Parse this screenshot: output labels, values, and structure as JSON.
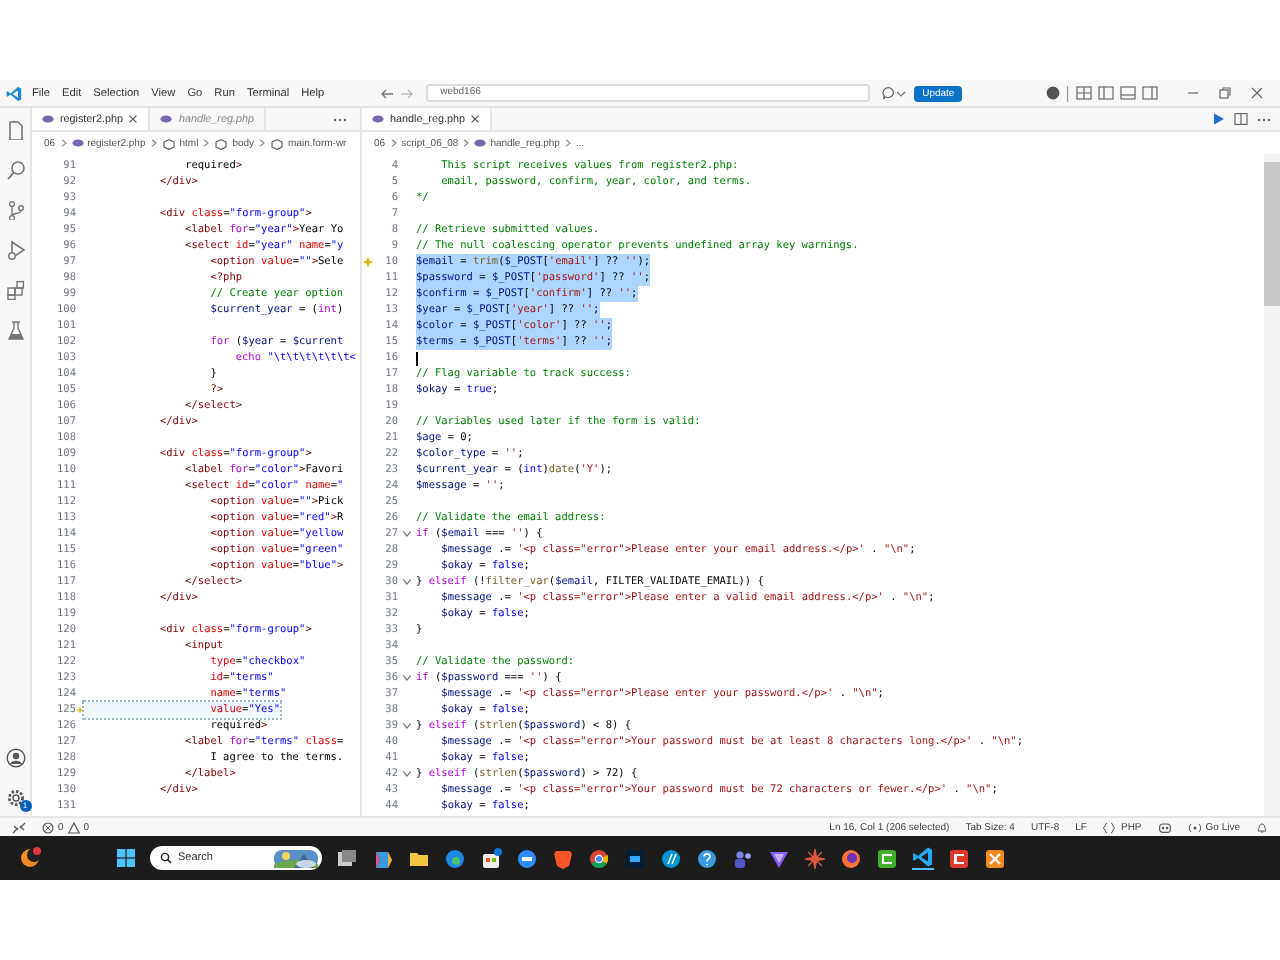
{
  "title_bar": {
    "menus": [
      "File",
      "Edit",
      "Selection",
      "View",
      "Go",
      "Run",
      "Terminal",
      "Help"
    ],
    "command_center": "webd166",
    "update_button": "Update"
  },
  "activity_bar": {
    "items": [
      {
        "kind": "explorer",
        "selected": false
      },
      {
        "kind": "search",
        "selected": false
      },
      {
        "kind": "source-control",
        "selected": false
      },
      {
        "kind": "run",
        "selected": false
      },
      {
        "kind": "extensions",
        "selected": false
      },
      {
        "kind": "testing",
        "selected": false
      }
    ],
    "settings_badge": "1"
  },
  "left_editor": {
    "tabs": [
      {
        "label": "register2.php",
        "selected": true,
        "preview": false
      },
      {
        "label": "handle_reg.php",
        "selected": false,
        "preview": true
      }
    ],
    "breadcrumbs": [
      {
        "kind": "folder",
        "label": "06"
      },
      {
        "kind": "file",
        "label": "register2.php"
      },
      {
        "kind": "element",
        "label": "html"
      },
      {
        "kind": "element",
        "label": "body"
      },
      {
        "kind": "element",
        "label": "main.form-wr"
      }
    ],
    "lines": [
      {
        "number": "91",
        "text": "                required>",
        "lightbulb": false,
        "highlighted": false
      },
      {
        "number": "92",
        "text": "            </div>",
        "lightbulb": false,
        "highlighted": false
      },
      {
        "number": "93",
        "lightbulb": false,
        "highlighted": false
      },
      {
        "number": "94",
        "text": "            <div class=\"form-group\">",
        "lightbulb": false,
        "highlighted": false
      },
      {
        "number": "95",
        "text": "                <label for=\"year\">Year Yo",
        "lightbulb": false,
        "highlighted": false
      },
      {
        "number": "96",
        "text": "                <select id=\"year\" name=\"y",
        "lightbulb": false,
        "highlighted": false
      },
      {
        "number": "97",
        "text": "                    <option value=\"\">Sele",
        "lightbulb": false,
        "highlighted": false
      },
      {
        "number": "98",
        "text": "                    <?php",
        "lightbulb": false,
        "highlighted": false
      },
      {
        "number": "99",
        "text": "                    // Create year option",
        "lightbulb": false,
        "highlighted": false
      },
      {
        "number": "100",
        "text": "                    $current_year = (int)",
        "lightbulb": false,
        "highlighted": false
      },
      {
        "number": "101",
        "lightbulb": false,
        "highlighted": false
      },
      {
        "number": "102",
        "text": "                    for ($year = $current",
        "lightbulb": false,
        "highlighted": false
      },
      {
        "number": "103",
        "text": "                        echo \"\\t\\t\\t\\t\\t\\t<",
        "lightbulb": false,
        "highlighted": false
      },
      {
        "number": "104",
        "text": "                    }",
        "lightbulb": false,
        "highlighted": false
      },
      {
        "number": "105",
        "text": "                    ?>",
        "lightbulb": false,
        "highlighted": false
      },
      {
        "number": "106",
        "text": "                </select>",
        "lightbulb": false,
        "highlighted": false
      },
      {
        "number": "107",
        "text": "            </div>",
        "lightbulb": false,
        "highlighted": false
      },
      {
        "number": "108",
        "lightbulb": false,
        "highlighted": false
      },
      {
        "number": "109",
        "text": "            <div class=\"form-group\">",
        "lightbulb": false,
        "highlighted": false
      },
      {
        "number": "110",
        "text": "                <label for=\"color\">Favori",
        "lightbulb": false,
        "highlighted": false
      },
      {
        "number": "111",
        "text": "                <select id=\"color\" name=\"",
        "lightbulb": false,
        "highlighted": false
      },
      {
        "number": "112",
        "text": "                    <option value=\"\">Pick",
        "lightbulb": false,
        "highlighted": false
      },
      {
        "number": "113",
        "text": "                    <option value=\"red\">R",
        "lightbulb": false,
        "highlighted": false
      },
      {
        "number": "114",
        "text": "                    <option value=\"yellow",
        "lightbulb": false,
        "highlighted": false
      },
      {
        "number": "115",
        "text": "                    <option value=\"green\"",
        "lightbulb": false,
        "highlighted": false
      },
      {
        "number": "116",
        "text": "                    <option value=\"blue\">",
        "lightbulb": false,
        "highlighted": false
      },
      {
        "number": "117",
        "text": "                </select>",
        "lightbulb": false,
        "highlighted": false
      },
      {
        "number": "118",
        "text": "            </div>",
        "lightbulb": false,
        "highlighted": false
      },
      {
        "number": "119",
        "lightbulb": false,
        "highlighted": false
      },
      {
        "number": "120",
        "text": "            <div class=\"form-group\">",
        "lightbulb": false,
        "highlighted": false
      },
      {
        "number": "121",
        "text": "                <input",
        "lightbulb": false,
        "highlighted": false
      },
      {
        "number": "122",
        "text": "                    type=\"checkbox\"",
        "lightbulb": false,
        "highlighted": false
      },
      {
        "number": "123",
        "text": "                    id=\"terms\"",
        "lightbulb": false,
        "highlighted": false
      },
      {
        "number": "124",
        "text": "                    name=\"terms\"",
        "lightbulb": false,
        "highlighted": false
      },
      {
        "number": "125",
        "text": "                    value=\"Yes\"",
        "lightbulb": true,
        "highlighted": true
      },
      {
        "number": "126",
        "text": "                    required>",
        "lightbulb": false,
        "highlighted": false
      },
      {
        "number": "127",
        "text": "                <label for=\"terms\" class=",
        "lightbulb": false,
        "highlighted": false
      },
      {
        "number": "128",
        "text": "                    I agree to the terms.",
        "lightbulb": false,
        "highlighted": false
      },
      {
        "number": "129",
        "text": "                </label>",
        "lightbulb": false,
        "highlighted": false
      },
      {
        "number": "130",
        "text": "            </div>",
        "lightbulb": false,
        "highlighted": false
      },
      {
        "number": "131",
        "lightbulb": false,
        "highlighted": false
      }
    ]
  },
  "right_editor": {
    "tabs": [
      {
        "label": "handle_reg.php",
        "selected": true,
        "preview": false
      }
    ],
    "breadcrumbs": [
      {
        "kind": "folder",
        "label": "06"
      },
      {
        "kind": "folder",
        "label": "script_06_08"
      },
      {
        "kind": "file",
        "label": "handle_reg.php"
      },
      {
        "kind": "more",
        "label": "..."
      }
    ],
    "lines": [
      {
        "number": "4",
        "kind": "comment",
        "text": "    This script receives values from register2.php:",
        "selected": false,
        "cursor": false,
        "foldable": false,
        "lightbulb": false
      },
      {
        "number": "5",
        "kind": "comment",
        "text": "    email, password, confirm, year, color, and terms.",
        "selected": false,
        "cursor": false,
        "foldable": false,
        "lightbulb": false
      },
      {
        "number": "6",
        "kind": "comment",
        "text": "*/",
        "selected": false,
        "cursor": false,
        "foldable": false,
        "lightbulb": false
      },
      {
        "number": "7",
        "kind": "blank",
        "selected": false,
        "cursor": false,
        "foldable": false,
        "lightbulb": false
      },
      {
        "number": "8",
        "kind": "code",
        "text": "// Retrieve submitted values.",
        "selected": false,
        "cursor": false,
        "foldable": false,
        "lightbulb": false
      },
      {
        "number": "9",
        "kind": "code",
        "text": "// The null coalescing operator prevents undefined array key warnings.",
        "selected": false,
        "cursor": false,
        "foldable": false,
        "lightbulb": false
      },
      {
        "number": "10",
        "kind": "code",
        "text": "$email = trim($_POST['email'] ?? '');",
        "selected": true,
        "cursor": false,
        "foldable": false,
        "lightbulb": true
      },
      {
        "number": "11",
        "kind": "code",
        "text": "$password = $_POST['password'] ?? '';",
        "selected": true,
        "cursor": false,
        "foldable": false,
        "lightbulb": false
      },
      {
        "number": "12",
        "kind": "code",
        "text": "$confirm = $_POST['confirm'] ?? '';",
        "selected": true,
        "cursor": false,
        "foldable": false,
        "lightbulb": false
      },
      {
        "number": "13",
        "kind": "code",
        "text": "$year = $_POST['year'] ?? '';",
        "selected": true,
        "cursor": false,
        "foldable": false,
        "lightbulb": false
      },
      {
        "number": "14",
        "kind": "code",
        "text": "$color = $_POST['color'] ?? '';",
        "selected": true,
        "cursor": false,
        "foldable": false,
        "lightbulb": false
      },
      {
        "number": "15",
        "kind": "code",
        "text": "$terms = $_POST['terms'] ?? '';",
        "selected": true,
        "cursor": false,
        "foldable": false,
        "lightbulb": false
      },
      {
        "number": "16",
        "kind": "blank",
        "selected": false,
        "cursor": true,
        "foldable": false,
        "lightbulb": false
      },
      {
        "number": "17",
        "kind": "code",
        "text": "// Flag variable to track success:",
        "selected": false,
        "cursor": false,
        "foldable": false,
        "lightbulb": false
      },
      {
        "number": "18",
        "kind": "code",
        "text": "$okay = true;",
        "selected": false,
        "cursor": false,
        "foldable": false,
        "lightbulb": false
      },
      {
        "number": "19",
        "kind": "blank",
        "selected": false,
        "cursor": false,
        "foldable": false,
        "lightbulb": false
      },
      {
        "number": "20",
        "kind": "code",
        "text": "// Variables used later if the form is valid:",
        "selected": false,
        "cursor": false,
        "foldable": false,
        "lightbulb": false
      },
      {
        "number": "21",
        "kind": "code",
        "text": "$age = 0;",
        "selected": false,
        "cursor": false,
        "foldable": false,
        "lightbulb": false
      },
      {
        "number": "22",
        "kind": "code",
        "text": "$color_type = '';",
        "selected": false,
        "cursor": false,
        "foldable": false,
        "lightbulb": false
      },
      {
        "number": "23",
        "kind": "code",
        "text": "$current_year = (int)date('Y');",
        "selected": false,
        "cursor": false,
        "foldable": false,
        "lightbulb": false
      },
      {
        "number": "24",
        "kind": "code",
        "text": "$message = '';",
        "selected": false,
        "cursor": false,
        "foldable": false,
        "lightbulb": false
      },
      {
        "number": "25",
        "kind": "blank",
        "selected": false,
        "cursor": false,
        "foldable": false,
        "lightbulb": false
      },
      {
        "number": "26",
        "kind": "code",
        "text": "// Validate the email address:",
        "selected": false,
        "cursor": false,
        "foldable": false,
        "lightbulb": false
      },
      {
        "number": "27",
        "kind": "code",
        "text": "if ($email === '') {",
        "selected": false,
        "cursor": false,
        "foldable": true,
        "lightbulb": false
      },
      {
        "number": "28",
        "kind": "code",
        "text": "    $message .= '<p class=\"error\">Please enter your email address.</p>' . \"\\n\";",
        "selected": false,
        "cursor": false,
        "foldable": false,
        "lightbulb": false
      },
      {
        "number": "29",
        "kind": "code",
        "text": "    $okay = false;",
        "selected": false,
        "cursor": false,
        "foldable": false,
        "lightbulb": false
      },
      {
        "number": "30",
        "kind": "code",
        "text": "} elseif (!filter_var($email, FILTER_VALIDATE_EMAIL)) {",
        "selected": false,
        "cursor": false,
        "foldable": true,
        "lightbulb": false
      },
      {
        "number": "31",
        "kind": "code",
        "text": "    $message .= '<p class=\"error\">Please enter a valid email address.</p>' . \"\\n\";",
        "selected": false,
        "cursor": false,
        "foldable": false,
        "lightbulb": false
      },
      {
        "number": "32",
        "kind": "code",
        "text": "    $okay = false;",
        "selected": false,
        "cursor": false,
        "foldable": false,
        "lightbulb": false
      },
      {
        "number": "33",
        "kind": "code",
        "text": "}",
        "selected": false,
        "cursor": false,
        "foldable": false,
        "lightbulb": false
      },
      {
        "number": "34",
        "kind": "blank",
        "selected": false,
        "cursor": false,
        "foldable": false,
        "lightbulb": false
      },
      {
        "number": "35",
        "kind": "code",
        "text": "// Validate the password:",
        "selected": false,
        "cursor": false,
        "foldable": false,
        "lightbulb": false
      },
      {
        "number": "36",
        "kind": "code",
        "text": "if ($password === '') {",
        "selected": false,
        "cursor": false,
        "foldable": true,
        "lightbulb": false
      },
      {
        "number": "37",
        "kind": "code",
        "text": "    $message .= '<p class=\"error\">Please enter your password.</p>' . \"\\n\";",
        "selected": false,
        "cursor": false,
        "foldable": false,
        "lightbulb": false
      },
      {
        "number": "38",
        "kind": "code",
        "text": "    $okay = false;",
        "selected": false,
        "cursor": false,
        "foldable": false,
        "lightbulb": false
      },
      {
        "number": "39",
        "kind": "code",
        "text": "} elseif (strlen($password) < 8) {",
        "selected": false,
        "cursor": false,
        "foldable": true,
        "lightbulb": false
      },
      {
        "number": "40",
        "kind": "code",
        "text": "    $message .= '<p class=\"error\">Your password must be at least 8 characters long.</p>' . \"\\n\";",
        "selected": false,
        "cursor": false,
        "foldable": false,
        "lightbulb": false
      },
      {
        "number": "41",
        "kind": "code",
        "text": "    $okay = false;",
        "selected": false,
        "cursor": false,
        "foldable": false,
        "lightbulb": false
      },
      {
        "number": "42",
        "kind": "code",
        "text": "} elseif (strlen($password) > 72) {",
        "selected": false,
        "cursor": false,
        "foldable": true,
        "lightbulb": false
      },
      {
        "number": "43",
        "kind": "code",
        "text": "    $message .= '<p class=\"error\">Your password must be 72 characters or fewer.</p>' . \"\\n\";",
        "selected": false,
        "cursor": false,
        "foldable": false,
        "lightbulb": false
      },
      {
        "number": "44",
        "kind": "code",
        "text": "    $okay = false;",
        "selected": false,
        "cursor": false,
        "foldable": false,
        "lightbulb": false
      }
    ]
  },
  "status_bar": {
    "errors": "0",
    "warnings": "0",
    "position": "Ln 16, Col 1 (206 selected)",
    "tab_size": "Tab Size: 4",
    "encoding": "UTF-8",
    "line_ending": "LF",
    "language": "PHP",
    "go_live": "Go Live"
  },
  "taskbar": {
    "search_placeholder": "Search"
  }
}
